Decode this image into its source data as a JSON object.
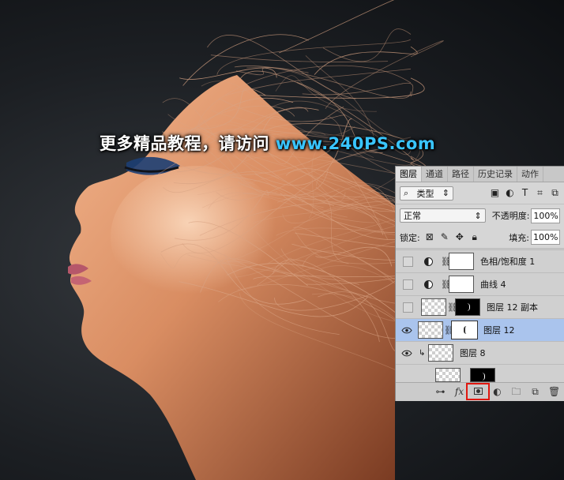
{
  "artwork": {
    "watermark_text": "更多精品教程，请访问",
    "watermark_url": "www.240PS.com",
    "watermark_color": "#ffffff",
    "url_color": "#39c5ff"
  },
  "layers_panel": {
    "tabs": [
      "图层",
      "通道",
      "路径",
      "历史记录",
      "动作"
    ],
    "active_tab": "图层",
    "filter": {
      "kind_label": "类型",
      "icons": [
        "search-icon",
        "image-filter-icon",
        "adjustment-filter-icon",
        "type-filter-icon",
        "shape-filter-icon",
        "smart-object-filter-icon"
      ]
    },
    "blend_mode": "正常",
    "opacity_label": "不透明度:",
    "opacity_value": "100%",
    "lock_label": "锁定:",
    "fill_label": "填充:",
    "fill_value": "100%",
    "layers": [
      {
        "name": "色相/饱和度 1",
        "visible": false,
        "type": "adjustment"
      },
      {
        "name": "曲线 4",
        "visible": false,
        "type": "adjustment"
      },
      {
        "name": "图层 12 副本",
        "visible": false,
        "type": "pixel-with-mask"
      },
      {
        "name": "图层 12",
        "visible": true,
        "type": "pixel-with-mask",
        "selected": true
      },
      {
        "name": "图层 8",
        "visible": true,
        "type": "pixel-clipped"
      }
    ],
    "bottom_icons": [
      "link-layers-icon",
      "fx-icon",
      "add-mask-icon",
      "new-adjustment-icon",
      "new-group-icon",
      "new-layer-icon",
      "trash-icon"
    ],
    "highlight_color": "#e0170f"
  }
}
